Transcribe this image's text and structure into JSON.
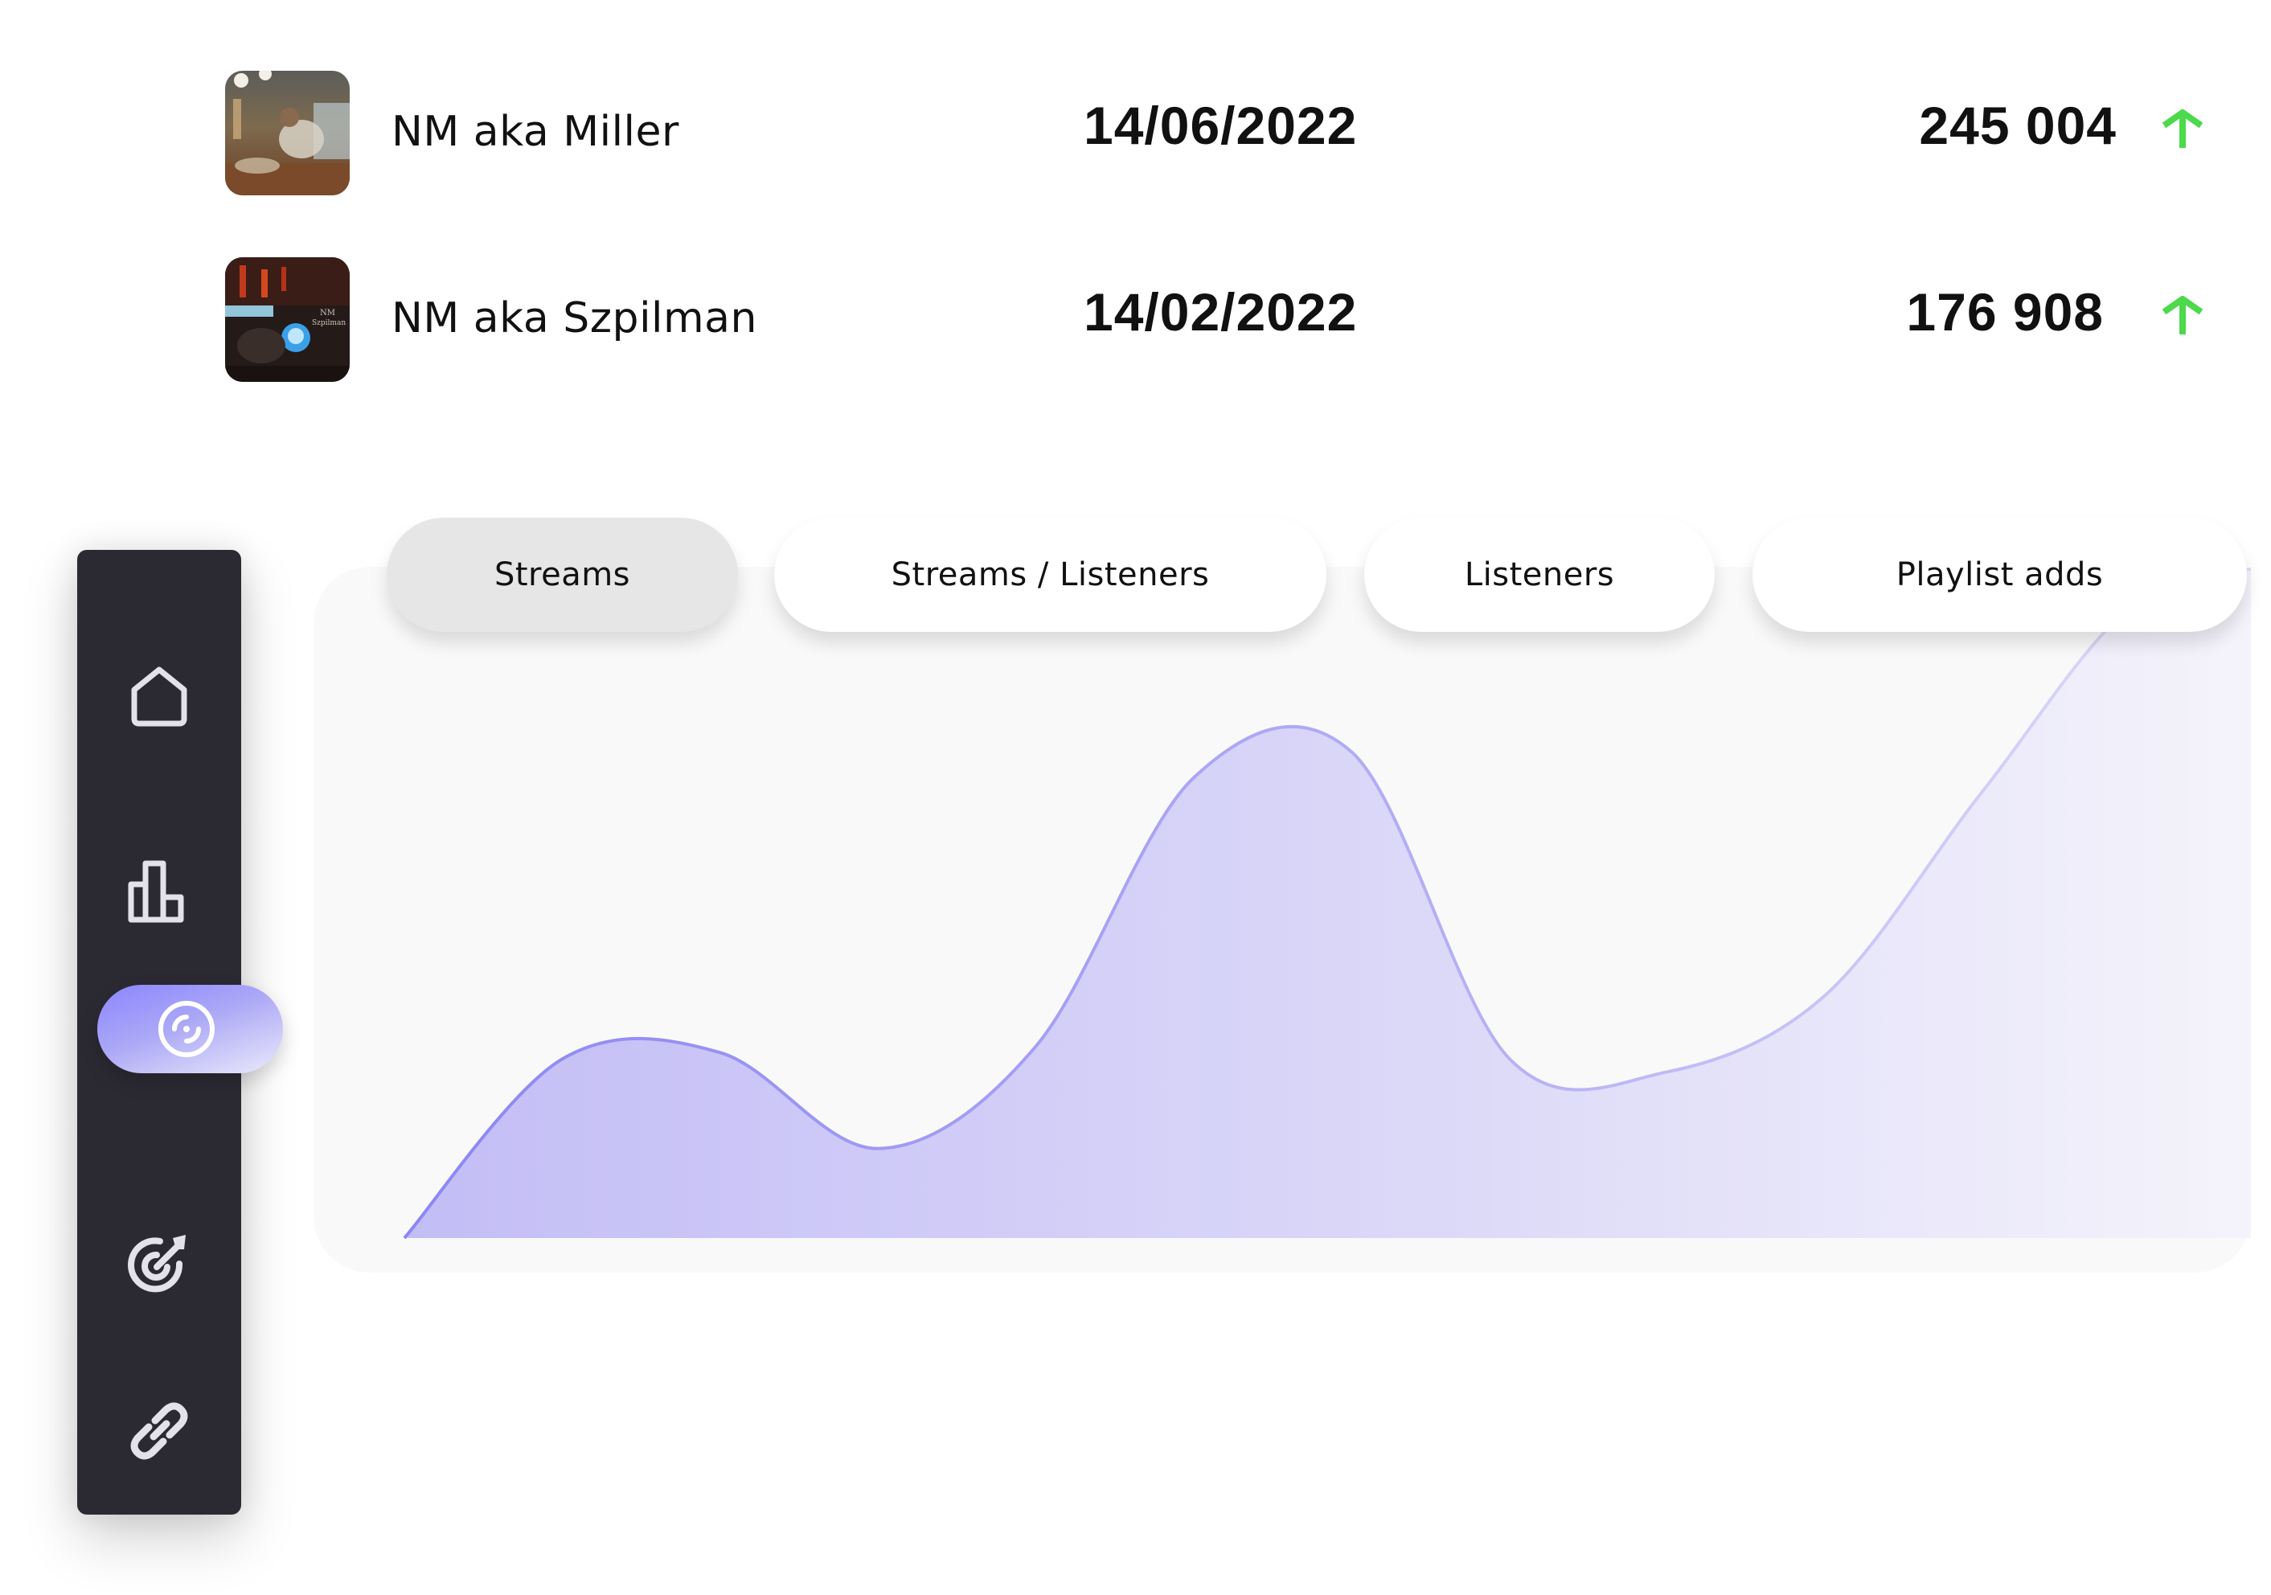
{
  "tracks": [
    {
      "name": "NM aka Miller",
      "date": "14/06/2022",
      "count": "245 004",
      "trend": "up",
      "thumbnail_icon": "album-cover-miller"
    },
    {
      "name": "NM aka Szpilman",
      "date": "14/02/2022",
      "count": "176 908",
      "trend": "up",
      "thumbnail_icon": "album-cover-szpilman"
    }
  ],
  "tabs": [
    {
      "label": "Streams",
      "active": true
    },
    {
      "label": "Streams / Listeners",
      "active": false
    },
    {
      "label": "Listeners",
      "active": false
    },
    {
      "label": "Playlist adds",
      "active": false
    }
  ],
  "sidebar": {
    "items": [
      {
        "icon": "home-icon",
        "active": false
      },
      {
        "icon": "bar-chart-icon",
        "active": false
      },
      {
        "icon": "disc-icon",
        "active": true
      },
      {
        "icon": "target-icon",
        "active": false
      },
      {
        "icon": "link-icon",
        "active": false
      }
    ]
  },
  "colors": {
    "trend_up": "#4cd94c",
    "sidebar_bg": "#2b2a33",
    "accent": "#8b85ff",
    "area_fill": "#c5c0f6",
    "area_stroke": "#9a94f5"
  },
  "chart_data": {
    "type": "area",
    "title": "",
    "series_name": "Streams",
    "xlabel": "",
    "ylabel": "",
    "grid": false,
    "legend": "none",
    "x": [
      0,
      1,
      2,
      3,
      4,
      5,
      6,
      7,
      8,
      9,
      10,
      11,
      12
    ],
    "values": [
      0,
      0.28,
      0.29,
      0.14,
      0.3,
      0.72,
      0.76,
      0.28,
      0.26,
      0.38,
      0.7,
      1.0,
      1.05
    ],
    "ylim": [
      0,
      1.1
    ]
  }
}
